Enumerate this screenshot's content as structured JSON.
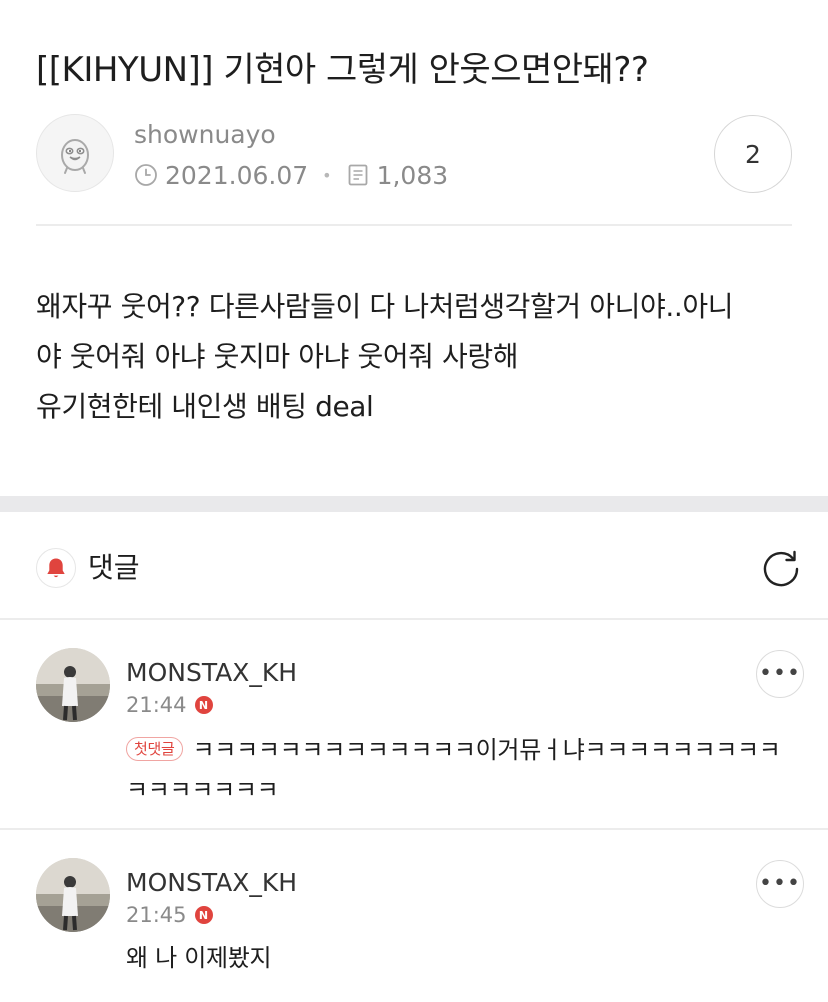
{
  "post": {
    "title": "[[KIHYUN]] 기현아 그렇게 안웃으면안돼??",
    "author": "shownuayo",
    "date": "2021.06.07",
    "views": "1,083",
    "comment_count": "2",
    "body_lines": [
      "왜자꾸 웃어?? 다른사람들이 다 나처럼생각할거 아니야..아니",
      "야 웃어줘 아냐 웃지마 아냐 웃어줘 사랑해",
      "유기현한테 내인생 배팅 deal"
    ]
  },
  "comments_section": {
    "title": "댓글"
  },
  "comments": [
    {
      "author": "MONSTAX_KH",
      "time": "21:44",
      "new_badge": "N",
      "first_badge": "첫댓글",
      "text": "ㅋㅋㅋㅋㅋㅋㅋㅋㅋㅋㅋㅋㅋ이거뮤ㅓ냐ㅋㅋㅋㅋㅋㅋㅋㅋㅋㅋㅋㅋㅋㅋㅋㅋ"
    },
    {
      "author": "MONSTAX_KH",
      "time": "21:45",
      "new_badge": "N",
      "text": "왜 나 이제봤지"
    }
  ],
  "icons": {
    "author_avatar": "duck-character-icon",
    "date": "clock-icon",
    "views": "document-icon",
    "comments_header": "bell-icon",
    "refresh": "refresh-icon",
    "more": "more-dots-icon"
  },
  "colors": {
    "accent_red": "#e0443e",
    "text_primary": "#1e1e1e",
    "text_secondary": "#8a8a8a",
    "divider": "#ececec",
    "section_band": "#e9e9eb"
  }
}
